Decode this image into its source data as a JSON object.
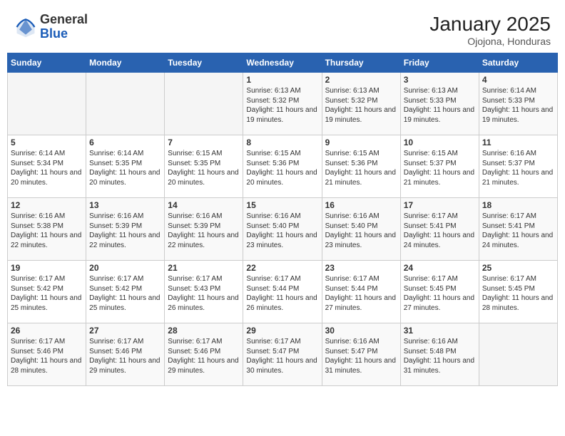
{
  "header": {
    "logo_general": "General",
    "logo_blue": "Blue",
    "month_title": "January 2025",
    "location": "Ojojona, Honduras"
  },
  "weekdays": [
    "Sunday",
    "Monday",
    "Tuesday",
    "Wednesday",
    "Thursday",
    "Friday",
    "Saturday"
  ],
  "weeks": [
    [
      {
        "day": "",
        "info": ""
      },
      {
        "day": "",
        "info": ""
      },
      {
        "day": "",
        "info": ""
      },
      {
        "day": "1",
        "info": "Sunrise: 6:13 AM\nSunset: 5:32 PM\nDaylight: 11 hours\nand 19 minutes."
      },
      {
        "day": "2",
        "info": "Sunrise: 6:13 AM\nSunset: 5:32 PM\nDaylight: 11 hours\nand 19 minutes."
      },
      {
        "day": "3",
        "info": "Sunrise: 6:13 AM\nSunset: 5:33 PM\nDaylight: 11 hours\nand 19 minutes."
      },
      {
        "day": "4",
        "info": "Sunrise: 6:14 AM\nSunset: 5:33 PM\nDaylight: 11 hours\nand 19 minutes."
      }
    ],
    [
      {
        "day": "5",
        "info": "Sunrise: 6:14 AM\nSunset: 5:34 PM\nDaylight: 11 hours\nand 20 minutes."
      },
      {
        "day": "6",
        "info": "Sunrise: 6:14 AM\nSunset: 5:35 PM\nDaylight: 11 hours\nand 20 minutes."
      },
      {
        "day": "7",
        "info": "Sunrise: 6:15 AM\nSunset: 5:35 PM\nDaylight: 11 hours\nand 20 minutes."
      },
      {
        "day": "8",
        "info": "Sunrise: 6:15 AM\nSunset: 5:36 PM\nDaylight: 11 hours\nand 20 minutes."
      },
      {
        "day": "9",
        "info": "Sunrise: 6:15 AM\nSunset: 5:36 PM\nDaylight: 11 hours\nand 21 minutes."
      },
      {
        "day": "10",
        "info": "Sunrise: 6:15 AM\nSunset: 5:37 PM\nDaylight: 11 hours\nand 21 minutes."
      },
      {
        "day": "11",
        "info": "Sunrise: 6:16 AM\nSunset: 5:37 PM\nDaylight: 11 hours\nand 21 minutes."
      }
    ],
    [
      {
        "day": "12",
        "info": "Sunrise: 6:16 AM\nSunset: 5:38 PM\nDaylight: 11 hours\nand 22 minutes."
      },
      {
        "day": "13",
        "info": "Sunrise: 6:16 AM\nSunset: 5:39 PM\nDaylight: 11 hours\nand 22 minutes."
      },
      {
        "day": "14",
        "info": "Sunrise: 6:16 AM\nSunset: 5:39 PM\nDaylight: 11 hours\nand 22 minutes."
      },
      {
        "day": "15",
        "info": "Sunrise: 6:16 AM\nSunset: 5:40 PM\nDaylight: 11 hours\nand 23 minutes."
      },
      {
        "day": "16",
        "info": "Sunrise: 6:16 AM\nSunset: 5:40 PM\nDaylight: 11 hours\nand 23 minutes."
      },
      {
        "day": "17",
        "info": "Sunrise: 6:17 AM\nSunset: 5:41 PM\nDaylight: 11 hours\nand 24 minutes."
      },
      {
        "day": "18",
        "info": "Sunrise: 6:17 AM\nSunset: 5:41 PM\nDaylight: 11 hours\nand 24 minutes."
      }
    ],
    [
      {
        "day": "19",
        "info": "Sunrise: 6:17 AM\nSunset: 5:42 PM\nDaylight: 11 hours\nand 25 minutes."
      },
      {
        "day": "20",
        "info": "Sunrise: 6:17 AM\nSunset: 5:42 PM\nDaylight: 11 hours\nand 25 minutes."
      },
      {
        "day": "21",
        "info": "Sunrise: 6:17 AM\nSunset: 5:43 PM\nDaylight: 11 hours\nand 26 minutes."
      },
      {
        "day": "22",
        "info": "Sunrise: 6:17 AM\nSunset: 5:44 PM\nDaylight: 11 hours\nand 26 minutes."
      },
      {
        "day": "23",
        "info": "Sunrise: 6:17 AM\nSunset: 5:44 PM\nDaylight: 11 hours\nand 27 minutes."
      },
      {
        "day": "24",
        "info": "Sunrise: 6:17 AM\nSunset: 5:45 PM\nDaylight: 11 hours\nand 27 minutes."
      },
      {
        "day": "25",
        "info": "Sunrise: 6:17 AM\nSunset: 5:45 PM\nDaylight: 11 hours\nand 28 minutes."
      }
    ],
    [
      {
        "day": "26",
        "info": "Sunrise: 6:17 AM\nSunset: 5:46 PM\nDaylight: 11 hours\nand 28 minutes."
      },
      {
        "day": "27",
        "info": "Sunrise: 6:17 AM\nSunset: 5:46 PM\nDaylight: 11 hours\nand 29 minutes."
      },
      {
        "day": "28",
        "info": "Sunrise: 6:17 AM\nSunset: 5:46 PM\nDaylight: 11 hours\nand 29 minutes."
      },
      {
        "day": "29",
        "info": "Sunrise: 6:17 AM\nSunset: 5:47 PM\nDaylight: 11 hours\nand 30 minutes."
      },
      {
        "day": "30",
        "info": "Sunrise: 6:16 AM\nSunset: 5:47 PM\nDaylight: 11 hours\nand 31 minutes."
      },
      {
        "day": "31",
        "info": "Sunrise: 6:16 AM\nSunset: 5:48 PM\nDaylight: 11 hours\nand 31 minutes."
      },
      {
        "day": "",
        "info": ""
      }
    ]
  ]
}
